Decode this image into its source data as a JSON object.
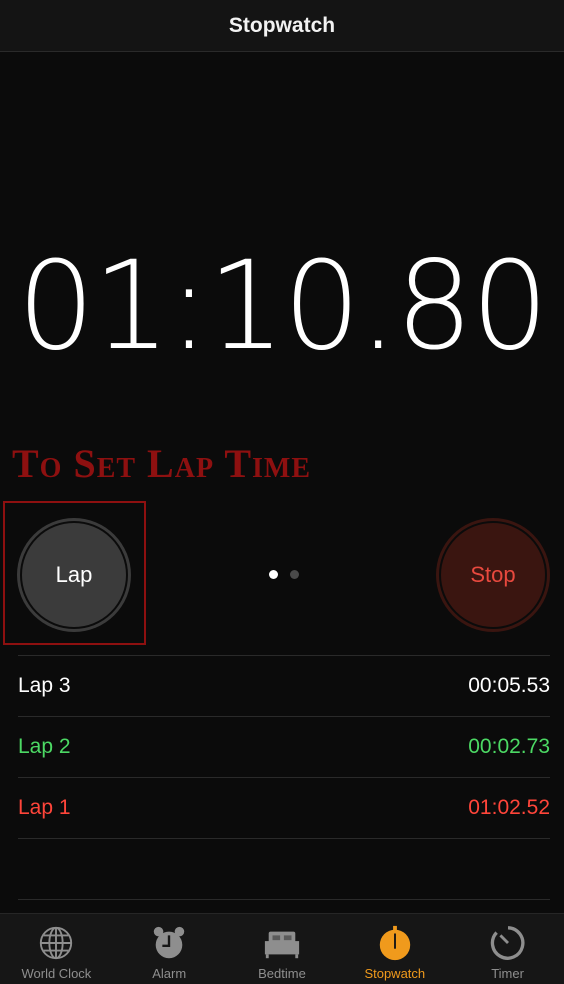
{
  "header": {
    "title": "Stopwatch"
  },
  "timer": {
    "display": "01:10.80"
  },
  "annotation": {
    "text": "To Set Lap Time",
    "color": "#8e1010"
  },
  "buttons": {
    "lap": "Lap",
    "stop": "Stop"
  },
  "pager": {
    "pages": 2,
    "current": 1
  },
  "laps": [
    {
      "label": "Lap 3",
      "time": "00:05.53",
      "color": "#ffffff"
    },
    {
      "label": "Lap 2",
      "time": "00:02.73",
      "color": "#4cd964"
    },
    {
      "label": "Lap 1",
      "time": "01:02.52",
      "color": "#ff453a"
    }
  ],
  "tabs": [
    {
      "label": "World Clock",
      "icon": "globe-icon"
    },
    {
      "label": "Alarm",
      "icon": "alarm-clock-icon"
    },
    {
      "label": "Bedtime",
      "icon": "bed-icon"
    },
    {
      "label": "Stopwatch",
      "icon": "stopwatch-icon",
      "active": true
    },
    {
      "label": "Timer",
      "icon": "timer-icon"
    }
  ],
  "colors": {
    "accent": "#f09a1c",
    "stop": "#e8493e"
  }
}
